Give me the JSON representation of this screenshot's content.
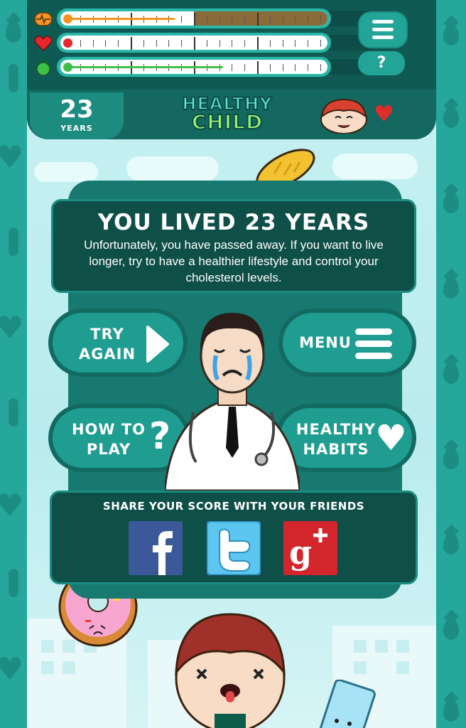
{
  "hud": {
    "bars": [
      {
        "name": "cholesterol",
        "icon": "heartbeat-icon",
        "fill_fraction": 0.43,
        "fill_color": "#f7931e",
        "tail_color": "#8b6a3a"
      },
      {
        "name": "health",
        "icon": "heart-icon",
        "fill_fraction": 0.02,
        "fill_color": "#e8242d"
      },
      {
        "name": "nutrition",
        "icon": "apple-icon",
        "fill_fraction": 0.62,
        "fill_color": "#3fc04a"
      }
    ],
    "help_label": "?",
    "age_value": "23",
    "age_unit": "YEARS",
    "logo_line1": "HEALTHY",
    "logo_line2": "CHILD"
  },
  "result": {
    "title": "YOU LIVED 23 YEARS",
    "message": "Unfortunately, you have passed away. If you want to live longer, try to have a healthier lifestyle and control your cholesterol levels."
  },
  "buttons": {
    "try_again_line1": "TRY",
    "try_again_line2": "AGAIN",
    "menu": "MENU",
    "how_to_play_line1": "HOW TO",
    "how_to_play_line2": "PLAY",
    "healthy_habits_line1": "HEALTHY",
    "healthy_habits_line2": "HABITS"
  },
  "share": {
    "title": "SHARE YOUR SCORE WITH YOUR FRIENDS",
    "networks": [
      {
        "name": "facebook",
        "color": "#3b5998",
        "glyph": "f"
      },
      {
        "name": "twitter",
        "color": "#5cc6f0",
        "glyph": "t"
      },
      {
        "name": "google-plus",
        "color": "#d3262c",
        "glyph": "g+"
      }
    ]
  },
  "colors": {
    "accent": "#1e9d90",
    "dark_panel": "#0e4f48",
    "heart_red": "#e22c2c"
  }
}
